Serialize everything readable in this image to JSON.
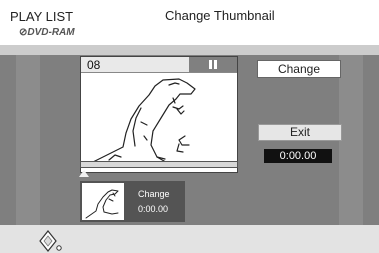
{
  "header": {
    "title": "PLAY LIST",
    "subtitle": "Change Thumbnail",
    "media_glyph": "⊘",
    "media_label": "DVD-RAM"
  },
  "player": {
    "scene_number": "08",
    "state_icon": "pause-icon",
    "progress_marker_icon": "triangle-up-icon"
  },
  "thumbnail": {
    "label": "Change",
    "time": "0:00.00"
  },
  "buttons": {
    "change_label": "Change",
    "exit_label": "Exit"
  },
  "timecode": "0:00.00",
  "footer": {
    "nav_icon": "dpad-icon"
  },
  "colors": {
    "header_bg": "#ffffff",
    "panel_bg": "#7f7f7f",
    "footer_bg": "#e3e3e3",
    "button_bg": "#ffffff",
    "timecode_bg": "#111111"
  }
}
